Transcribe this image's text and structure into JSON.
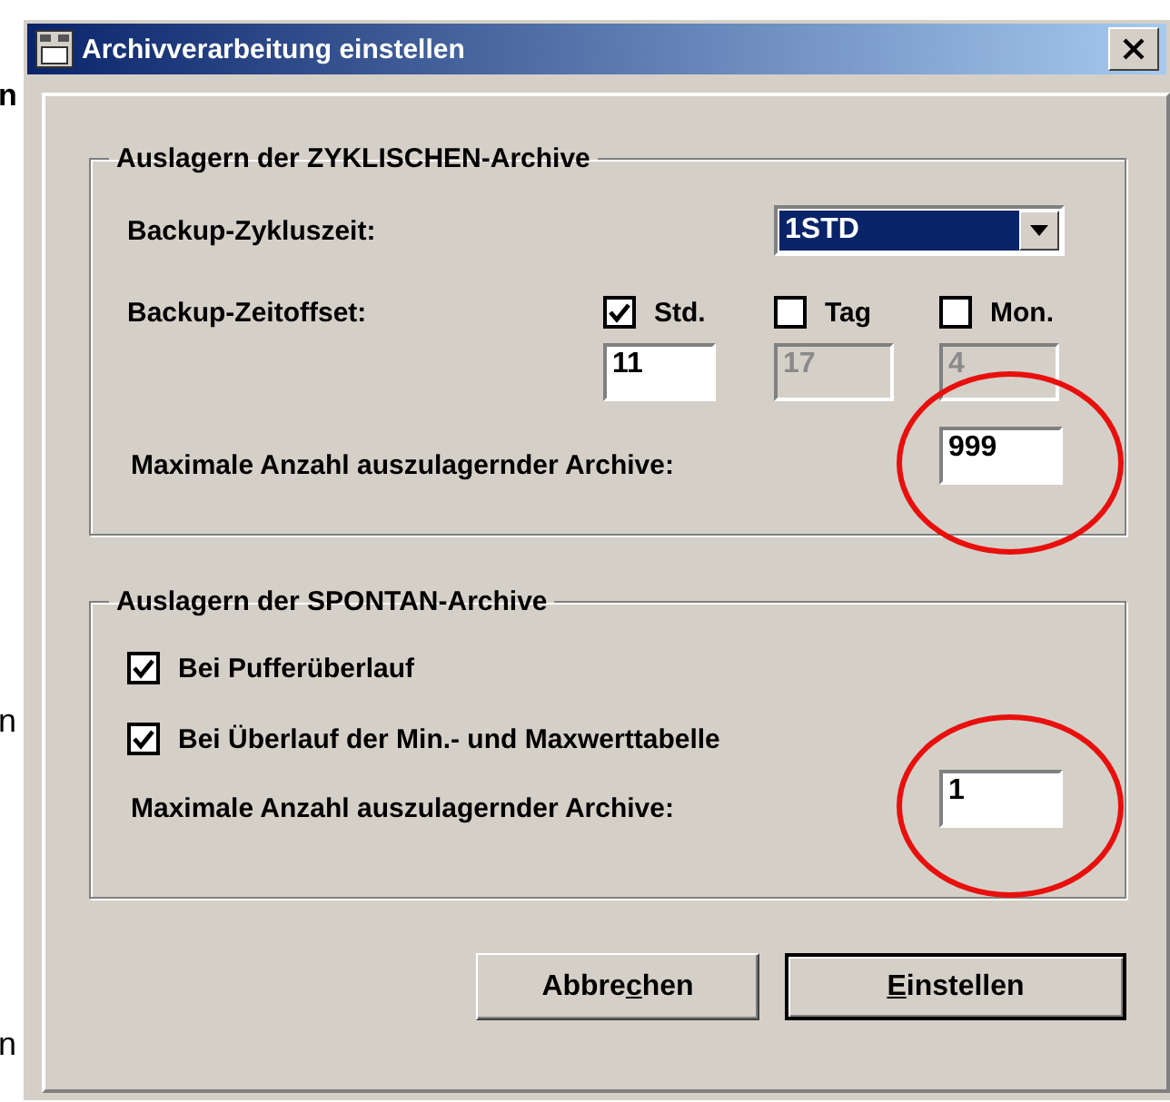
{
  "background_fragments": [
    {
      "text": "n",
      "bold": true
    },
    {
      "text": "n",
      "bold": false
    },
    {
      "text": "n",
      "bold": false
    }
  ],
  "window": {
    "title": "Archivverarbeitung einstellen"
  },
  "cyclic_group": {
    "title": "Auslagern der ZYKLISCHEN-Archive",
    "cycle_label": "Backup-Zykluszeit:",
    "cycle_value": "1STD",
    "offset_label": "Backup-Zeitoffset:",
    "offsets": [
      {
        "label": "Std.",
        "checked": true,
        "value": "11",
        "disabled": false
      },
      {
        "label": "Tag",
        "checked": false,
        "value": "17",
        "disabled": true
      },
      {
        "label": "Mon.",
        "checked": false,
        "value": "4",
        "disabled": true
      }
    ],
    "max_label": "Maximale Anzahl auszulagernder Archive:",
    "max_value": "999",
    "circled": true
  },
  "spontan_group": {
    "title": "Auslagern der SPONTAN-Archive",
    "options": [
      {
        "label": "Bei Pufferüberlauf",
        "checked": true
      },
      {
        "label": "Bei Überlauf der Min.- und Maxwerttabelle",
        "checked": true
      }
    ],
    "max_label": "Maximale Anzahl auszulagernder Archive:",
    "max_value": "1",
    "circled": true
  },
  "buttons": [
    {
      "before": "Abbre",
      "key": "c",
      "after": "hen",
      "default": false
    },
    {
      "key": "E",
      "after": "instellen",
      "default": true
    }
  ]
}
